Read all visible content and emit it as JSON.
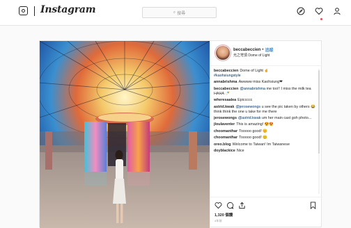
{
  "app": {
    "name": "Instagram",
    "search_placeholder": "搜尋",
    "icons": [
      "camera-icon",
      "search-icon",
      "explore-compass-icon",
      "heart-icon",
      "profile-icon"
    ],
    "notification_color": "#ed4956"
  },
  "post": {
    "author": "beccabeccien",
    "follow_separator": "•",
    "follow_label": "追蹤",
    "location": "光之穹頂 Dome of Light",
    "comments": [
      {
        "user": "beccabeccien",
        "text": "Dome of Light ✌",
        "tag": "#kaohsiungstyle"
      },
      {
        "user": "annabrishma",
        "text": "Awwww miss Kaohsiung❤"
      },
      {
        "user": "beccabeccien",
        "mention": "@annabrishma",
        "text": "me too!! I miss the milk tea HAHA 🍼"
      },
      {
        "user": "wheresaalea",
        "text": "Epiccccc"
      },
      {
        "user": "astrid.kwak",
        "mention": "@jerosewongs",
        "text": "u see the pic taken by others 😂 think think the one u take for me there"
      },
      {
        "user": "jerosewongs",
        "mention": "@astrid.kwak",
        "text": "um her main cast goh photo..."
      },
      {
        "user": "jloulaventer",
        "text": "This is amazing! 😍😍"
      },
      {
        "user": "choomanthar",
        "text": "Tooooo good! 😊"
      },
      {
        "user": "choomanthar",
        "text": "Tooooo good! 😊"
      },
      {
        "user": "oreo.blog",
        "text": "Welcome to Taiwan! Im Taiwanese"
      },
      {
        "user": "doyblackice",
        "text": "Nice"
      }
    ],
    "likes": "1,320 個讚",
    "date": "4年前"
  }
}
